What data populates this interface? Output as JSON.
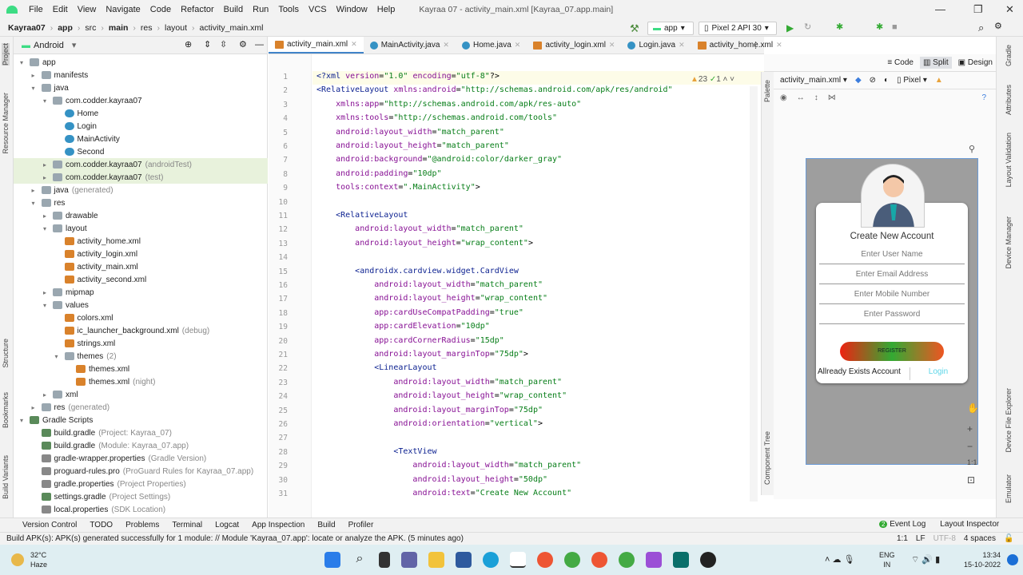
{
  "menu": {
    "items": [
      "File",
      "Edit",
      "View",
      "Navigate",
      "Code",
      "Refactor",
      "Build",
      "Run",
      "Tools",
      "VCS",
      "Window",
      "Help"
    ],
    "title": "Kayraa 07 - activity_main.xml [Kayraa_07.app.main]"
  },
  "breadcrumb": [
    "Kayraa07",
    "app",
    "src",
    "main",
    "res",
    "layout",
    "activity_main.xml"
  ],
  "toolbar": {
    "config": "app",
    "device": "Pixel 2 API 30"
  },
  "project": {
    "view": "Android",
    "tree": [
      {
        "l": 0,
        "t": "app",
        "k": "folder",
        "o": 1
      },
      {
        "l": 1,
        "t": "manifests",
        "k": "folder"
      },
      {
        "l": 1,
        "t": "java",
        "k": "folder",
        "o": 1
      },
      {
        "l": 2,
        "t": "com.codder.kayraa07",
        "k": "pkg",
        "o": 1
      },
      {
        "l": 3,
        "t": "Home",
        "k": "class"
      },
      {
        "l": 3,
        "t": "Login",
        "k": "class"
      },
      {
        "l": 3,
        "t": "MainActivity",
        "k": "class"
      },
      {
        "l": 3,
        "t": "Second",
        "k": "class"
      },
      {
        "l": 2,
        "t": "com.codder.kayraa07",
        "s": "(androidTest)",
        "k": "pkg",
        "h": 1
      },
      {
        "l": 2,
        "t": "com.codder.kayraa07",
        "s": "(test)",
        "k": "pkg",
        "h": 1
      },
      {
        "l": 1,
        "t": "java",
        "s": "(generated)",
        "k": "folder"
      },
      {
        "l": 1,
        "t": "res",
        "k": "folder",
        "o": 1
      },
      {
        "l": 2,
        "t": "drawable",
        "k": "folder"
      },
      {
        "l": 2,
        "t": "layout",
        "k": "folder",
        "o": 1
      },
      {
        "l": 3,
        "t": "activity_home.xml",
        "k": "xml"
      },
      {
        "l": 3,
        "t": "activity_login.xml",
        "k": "xml"
      },
      {
        "l": 3,
        "t": "activity_main.xml",
        "k": "xml"
      },
      {
        "l": 3,
        "t": "activity_second.xml",
        "k": "xml"
      },
      {
        "l": 2,
        "t": "mipmap",
        "k": "folder"
      },
      {
        "l": 2,
        "t": "values",
        "k": "folder",
        "o": 1
      },
      {
        "l": 3,
        "t": "colors.xml",
        "k": "xml"
      },
      {
        "l": 3,
        "t": "ic_launcher_background.xml",
        "s": "(debug)",
        "k": "xml"
      },
      {
        "l": 3,
        "t": "strings.xml",
        "k": "xml"
      },
      {
        "l": 3,
        "t": "themes",
        "s": "(2)",
        "k": "folder",
        "o": 1
      },
      {
        "l": 4,
        "t": "themes.xml",
        "k": "xml"
      },
      {
        "l": 4,
        "t": "themes.xml",
        "s": "(night)",
        "k": "xml"
      },
      {
        "l": 2,
        "t": "xml",
        "k": "folder"
      },
      {
        "l": 1,
        "t": "res",
        "s": "(generated)",
        "k": "folder"
      },
      {
        "l": 0,
        "t": "Gradle Scripts",
        "k": "gradle",
        "o": 1
      },
      {
        "l": 1,
        "t": "build.gradle",
        "s": "(Project: Kayraa_07)",
        "k": "gradle"
      },
      {
        "l": 1,
        "t": "build.gradle",
        "s": "(Module: Kayraa_07.app)",
        "k": "gradle"
      },
      {
        "l": 1,
        "t": "gradle-wrapper.properties",
        "s": "(Gradle Version)",
        "k": "prop"
      },
      {
        "l": 1,
        "t": "proguard-rules.pro",
        "s": "(ProGuard Rules for Kayraa_07.app)",
        "k": "prop"
      },
      {
        "l": 1,
        "t": "gradle.properties",
        "s": "(Project Properties)",
        "k": "prop"
      },
      {
        "l": 1,
        "t": "settings.gradle",
        "s": "(Project Settings)",
        "k": "gradle"
      },
      {
        "l": 1,
        "t": "local.properties",
        "s": "(SDK Location)",
        "k": "prop"
      }
    ]
  },
  "tabs": [
    {
      "label": "activity_main.xml",
      "k": "xml",
      "active": true
    },
    {
      "label": "MainActivity.java",
      "k": "c"
    },
    {
      "label": "Home.java",
      "k": "c"
    },
    {
      "label": "activity_login.xml",
      "k": "xml"
    },
    {
      "label": "Login.java",
      "k": "c"
    },
    {
      "label": "activity_home.xml",
      "k": "xml"
    }
  ],
  "editor": {
    "warnings": "23",
    "checks": "1",
    "lines": [
      "<?xml version=\"1.0\" encoding=\"utf-8\"?>",
      "<RelativeLayout xmlns:android=\"http://schemas.android.com/apk/res/android\"",
      "    xmlns:app=\"http://schemas.android.com/apk/res-auto\"",
      "    xmlns:tools=\"http://schemas.android.com/tools\"",
      "    android:layout_width=\"match_parent\"",
      "    android:layout_height=\"match_parent\"",
      "    android:background=\"@android:color/darker_gray\"",
      "    android:padding=\"10dp\"",
      "    tools:context=\".MainActivity\">",
      "",
      "    <RelativeLayout",
      "        android:layout_width=\"match_parent\"",
      "        android:layout_height=\"wrap_content\">",
      "",
      "        <androidx.cardview.widget.CardView",
      "            android:layout_width=\"match_parent\"",
      "            android:layout_height=\"wrap_content\"",
      "            app:cardUseCompatPadding=\"true\"",
      "            app:cardElevation=\"10dp\"",
      "            app:cardCornerRadius=\"15dp\"",
      "            android:layout_marginTop=\"75dp\">",
      "            <LinearLayout",
      "                android:layout_width=\"match_parent\"",
      "                android:layout_height=\"wrap_content\"",
      "                android:layout_marginTop=\"75dp\"",
      "                android:orientation=\"vertical\">",
      "",
      "                <TextView",
      "                    android:layout_width=\"match_parent\"",
      "                    android:layout_height=\"50dp\"",
      "                    android:text=\"Create New Account\""
    ]
  },
  "viewmodes": {
    "code": "Code",
    "split": "Split",
    "design": "Design"
  },
  "design": {
    "file": "activity_main.xml",
    "device": "Pixel",
    "title": "Create New Account",
    "fields": [
      "Enter User Name",
      "Enter Email Address",
      "Enter Mobile Number",
      "Enter Password"
    ],
    "register": "REGISTER",
    "exists": "Allready Exists Account",
    "login": "Login"
  },
  "left_stripe": [
    "Project",
    "Resource Manager",
    "Structure",
    "Bookmarks",
    "Build Variants"
  ],
  "right_stripe": [
    "Gradle",
    "Attributes",
    "Layout Validation",
    "Device Manager",
    "Device File Explorer",
    "Emulator"
  ],
  "palette": [
    "Palette",
    "Component Tree"
  ],
  "toolwindows": [
    "Version Control",
    "TODO",
    "Problems",
    "Terminal",
    "Logcat",
    "App Inspection",
    "Build",
    "Profiler"
  ],
  "toolwindows_right": [
    "Event Log",
    "Layout Inspector"
  ],
  "event_count": "2",
  "status": {
    "message": "Build APK(s): APK(s) generated successfully for 1 module: // Module 'Kayraa_07.app': locate or analyze the APK. (5 minutes ago)",
    "pos": "1:1",
    "eol": "LF",
    "enc": "UTF-8",
    "indent": "4 spaces"
  },
  "taskbar": {
    "temp": "32°C",
    "weather": "Haze",
    "lang": "ENG",
    "region": "IN",
    "time": "13:34",
    "date": "15-10-2022"
  }
}
